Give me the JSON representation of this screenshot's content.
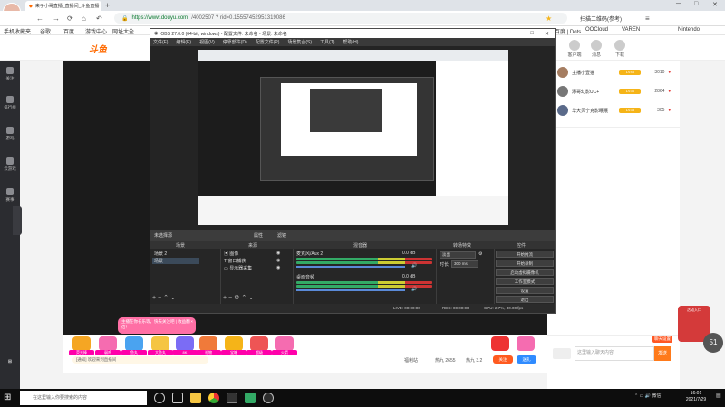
{
  "browser": {
    "tab_title": "来子小哥直播_直播间_斗鱼直播",
    "url_host": "https://www.douyu.com",
    "url_path": "/4002507 ? rid=0.15557452951319086",
    "bookmarks": [
      "手机收藏夹",
      "谷歌",
      "百度",
      "游戏中心",
      "网址大全",
      "百度 | Dots",
      "抖音 | CPT",
      "OOCloud",
      "抖音新版",
      "Nintendo"
    ],
    "extensions": [
      "扫描二维码(参考)",
      "[Stats]",
      "LOL组队工具",
      "VAREN",
      "Nintendo"
    ]
  },
  "site": {
    "logo_text": "斗鱼",
    "header_icons": [
      "客户端",
      "消息",
      "下载"
    ],
    "sidebar": [
      "关注",
      "排行榜",
      "游戏",
      "云游戏",
      "赛事"
    ],
    "ranking": [
      {
        "name": "主播小壹猫",
        "level": "LV45",
        "score": "3010"
      },
      {
        "name": "添哥幻影UC+",
        "level": "LV36",
        "score": "2864"
      },
      {
        "name": "华大贝宁克影眠眠",
        "level": "LV33",
        "score": "305"
      }
    ],
    "popup_text": "主播在你长乐等，快去关注吧 | 收益翻倍！",
    "notice": "[通知] 欢迎来到直播间",
    "room_info": [
      "福利站",
      "热九 2655",
      "热九 3.2"
    ],
    "buttons": {
      "follow": "关注",
      "gift": "送礼"
    },
    "chat_placeholder": "这里输入聊天内容",
    "send": "发送",
    "chat_badge": "聊天设置",
    "ad_text": "活动入口",
    "view_count": "51",
    "gifts": [
      {
        "label": "荧光棒",
        "price": "1鱼丸",
        "color": "#f5a623"
      },
      {
        "label": "弱鸡",
        "price": "特惠",
        "color": "#f56cb0"
      },
      {
        "label": "鱼丸",
        "price": "",
        "color": "#4aa3f0"
      },
      {
        "label": "大鱼丸",
        "price": "",
        "color": "#f5c542"
      },
      {
        "label": "8K",
        "price": "",
        "color": "#7b6cf5"
      },
      {
        "label": "礼物",
        "price": "",
        "color": "#f07a3a"
      },
      {
        "label": "宝箱",
        "price": "",
        "color": "#f5b418"
      },
      {
        "label": "超级",
        "price": "",
        "color": "#e55"
      },
      {
        "label": "火箭",
        "price": "",
        "color": "#f56cb0"
      }
    ]
  },
  "obs": {
    "title": "OBS 27.0.0 (64-bit, windows) - 配置文件: 未命名 - 场景: 未命名",
    "menu": [
      "文件(F)",
      "编辑(E)",
      "视图(V)",
      "停靠部件(D)",
      "配置文件(P)",
      "场景集合(S)",
      "工具(T)",
      "帮助(H)"
    ],
    "no_source": "未选择源",
    "properties": "属性",
    "filters": "滤镜",
    "panel_titles": [
      "场景",
      "来源",
      "混音器",
      "转场特效",
      "控件"
    ],
    "scenes": [
      "场景 2",
      "场景"
    ],
    "sources": [
      "图像",
      "窗口捕获",
      "显示器采集"
    ],
    "mixer": [
      {
        "name": "麦克风/Aux 2",
        "db": "0.0 dB"
      },
      {
        "name": "桌面音频",
        "db": "0.0 dB"
      }
    ],
    "transition": {
      "type": "淡出",
      "duration_label": "时长",
      "duration": "300 ms"
    },
    "controls": [
      "开始推流",
      "开始录制",
      "启动虚拟摄像机",
      "工作室模式",
      "设置",
      "退出"
    ],
    "status": [
      "LIVE: 00:00:00",
      "REC: 00:00:00",
      "CPU: 2.7%, 30.00 fps"
    ]
  },
  "taskbar": {
    "search_placeholder": "在这里输入你要搜索的内容",
    "tray": "微信",
    "time": "16:01",
    "date": "2021/7/29"
  }
}
